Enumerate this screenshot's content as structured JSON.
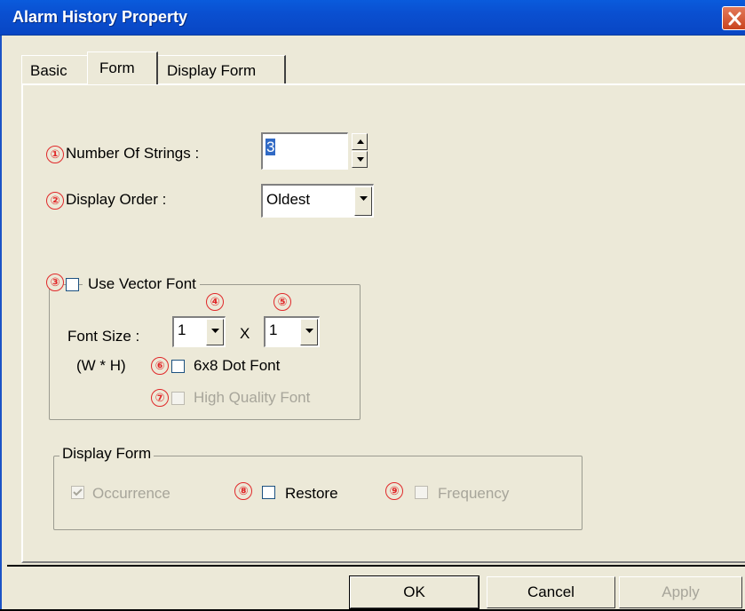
{
  "window": {
    "title": "Alarm History Property"
  },
  "tabs": {
    "basic": "Basic",
    "form": "Form",
    "display_form": "Display Form"
  },
  "form": {
    "number_of_strings": {
      "marker": "①",
      "label": "Number Of Strings :",
      "value": "3"
    },
    "display_order": {
      "marker": "②",
      "label": "Display Order :",
      "value": "Oldest"
    },
    "vector_font": {
      "marker": "③",
      "label": "Use Vector Font",
      "checked": false,
      "font_size_label": "Font Size :",
      "width_marker": "④",
      "width_value": "1",
      "times": "X",
      "height_marker": "⑤",
      "height_value": "1",
      "wh_label": "(W * H)",
      "dot_font": {
        "marker": "⑥",
        "label": "6x8 Dot Font",
        "checked": false
      },
      "high_quality": {
        "marker": "⑦",
        "label": "High Quality Font",
        "checked": false,
        "enabled": false
      }
    },
    "display_form_group": {
      "title": "Display Form",
      "occurrence": {
        "label": "Occurrence",
        "checked": true,
        "enabled": false
      },
      "restore": {
        "marker": "⑧",
        "label": "Restore",
        "checked": false
      },
      "frequency": {
        "marker": "⑨",
        "label": "Frequency",
        "checked": false,
        "enabled": false
      }
    }
  },
  "buttons": {
    "ok": "OK",
    "cancel": "Cancel",
    "apply": "Apply"
  },
  "icons": {
    "close": "close-icon",
    "spin_up": "arrow-up-icon",
    "spin_down": "arrow-down-icon",
    "dropdown": "dropdown-arrow-icon",
    "check": "check-icon"
  },
  "colors": {
    "titlebar": "#0a4fd0",
    "dialog": "#ece9d8",
    "marker": "#e0292a",
    "selection": "#316ac5"
  }
}
